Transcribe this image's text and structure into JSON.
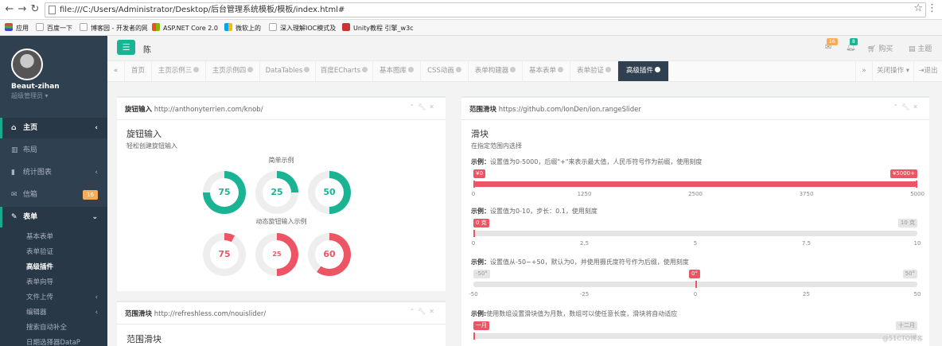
{
  "browser": {
    "url": "file:///C:/Users/Administrator/Desktop/后台管理系统模板/模板/index.html#",
    "bookmarks": [
      "应用",
      "百度一下",
      "博客园 - 开发者的网",
      "ASP.NET Core 2.0",
      "微软上的",
      "深入理解IOC模式及",
      "Unity教程 引擎_w3c"
    ]
  },
  "sidebar": {
    "user_name": "Beaut-zihan",
    "user_role": "超级管理员",
    "items": [
      {
        "label": "主页"
      },
      {
        "label": "布局"
      },
      {
        "label": "统计图表"
      },
      {
        "label": "信箱",
        "badge": "16"
      },
      {
        "label": "表单"
      }
    ],
    "subitems": [
      {
        "label": "基本表单"
      },
      {
        "label": "表单验证"
      },
      {
        "label": "高级插件"
      },
      {
        "label": "表单向导"
      },
      {
        "label": "文件上传"
      },
      {
        "label": "编辑器"
      },
      {
        "label": "搜索自动补全"
      },
      {
        "label": "日期选择器DataP"
      }
    ]
  },
  "topbar": {
    "char": "陈",
    "mail_badge": "16",
    "bell_badge": "8",
    "buy": "购买",
    "theme": "主题"
  },
  "tabs": [
    "首页",
    "主页示例三",
    "主页示例四",
    "DataTables",
    "百度ECharts",
    "基本图库",
    "CSS动画",
    "表单构建器",
    "基本表单",
    "表单验证",
    "高级插件"
  ],
  "tab_right": {
    "close_ops": "关闭操作",
    "logout": "退出"
  },
  "knob_panel": {
    "title": "旋钮输入",
    "url": "http://anthonyterrien.com/knob/",
    "heading": "旋钮输入",
    "sub": "轻松创建旋钮输入",
    "simple_label": "简单示例",
    "dynamic_label": "动态旋钮输入示例",
    "simple_values": [
      {
        "value": 75,
        "color": "#1ab394"
      },
      {
        "value": 25,
        "color": "#1ab394"
      },
      {
        "value": 50,
        "color": "#1ab394"
      }
    ],
    "dynamic_values": [
      {
        "value": 75,
        "color": "#ed5565",
        "fraction": 0.08
      },
      {
        "value": 25,
        "color": "#ed5565",
        "fraction": 0.5
      },
      {
        "value": 60,
        "color": "#ed5565",
        "fraction": 0.6
      }
    ]
  },
  "nouislider_panel": {
    "title": "范围滑块",
    "url": "http://refreshless.com/nouislider/",
    "heading": "范围滑块"
  },
  "range_panel": {
    "title": "范围滑块",
    "url": "https://github.com/IonDen/ion.rangeSlider",
    "heading": "滑块",
    "sub": "在指定范围内选择",
    "sliders": [
      {
        "desc_prefix": "示例：",
        "desc": "设置值为0-5000，后缀\"+\"来表示最大值，人民币符号作为前缀，使用刻度",
        "from_label": "¥0",
        "to_label": "¥5000+",
        "ticks": [
          "0",
          "1250",
          "2500",
          "3750",
          "5000"
        ],
        "fill_from": 0,
        "fill_to": 1
      },
      {
        "desc_prefix": "示例：",
        "desc": "设置值为0-10，步长：0.1，使用刻度",
        "from_label": "0 克",
        "to_label": "10 克",
        "ticks": [
          "0",
          "2.5",
          "5",
          "7.5",
          "10"
        ],
        "fill_from": 0,
        "fill_to": 0
      },
      {
        "desc_prefix": "示例：",
        "desc": "设置值从-50~+50，默认为0，并使用摄氏度符号作为后缀，使用刻度",
        "from_label": "-50°",
        "mid_label": "0°",
        "to_label": "50°",
        "ticks": [
          "-50",
          "-25",
          "0",
          "25",
          "50"
        ],
        "fill_from": 0.5,
        "fill_to": 0.5
      },
      {
        "desc_prefix": "示例:",
        "desc": "使用数组设置滑块值为月数，数组可以使任意长度，滑块将自动适应",
        "from_label": "一月",
        "to_label": "十二月",
        "ticks": [],
        "fill_from": 0,
        "fill_to": 0
      }
    ]
  },
  "watermark": "@51CTO博客",
  "colors": {
    "accent": "#1ab394",
    "danger": "#ed5565",
    "sidebar": "#2f4050"
  }
}
